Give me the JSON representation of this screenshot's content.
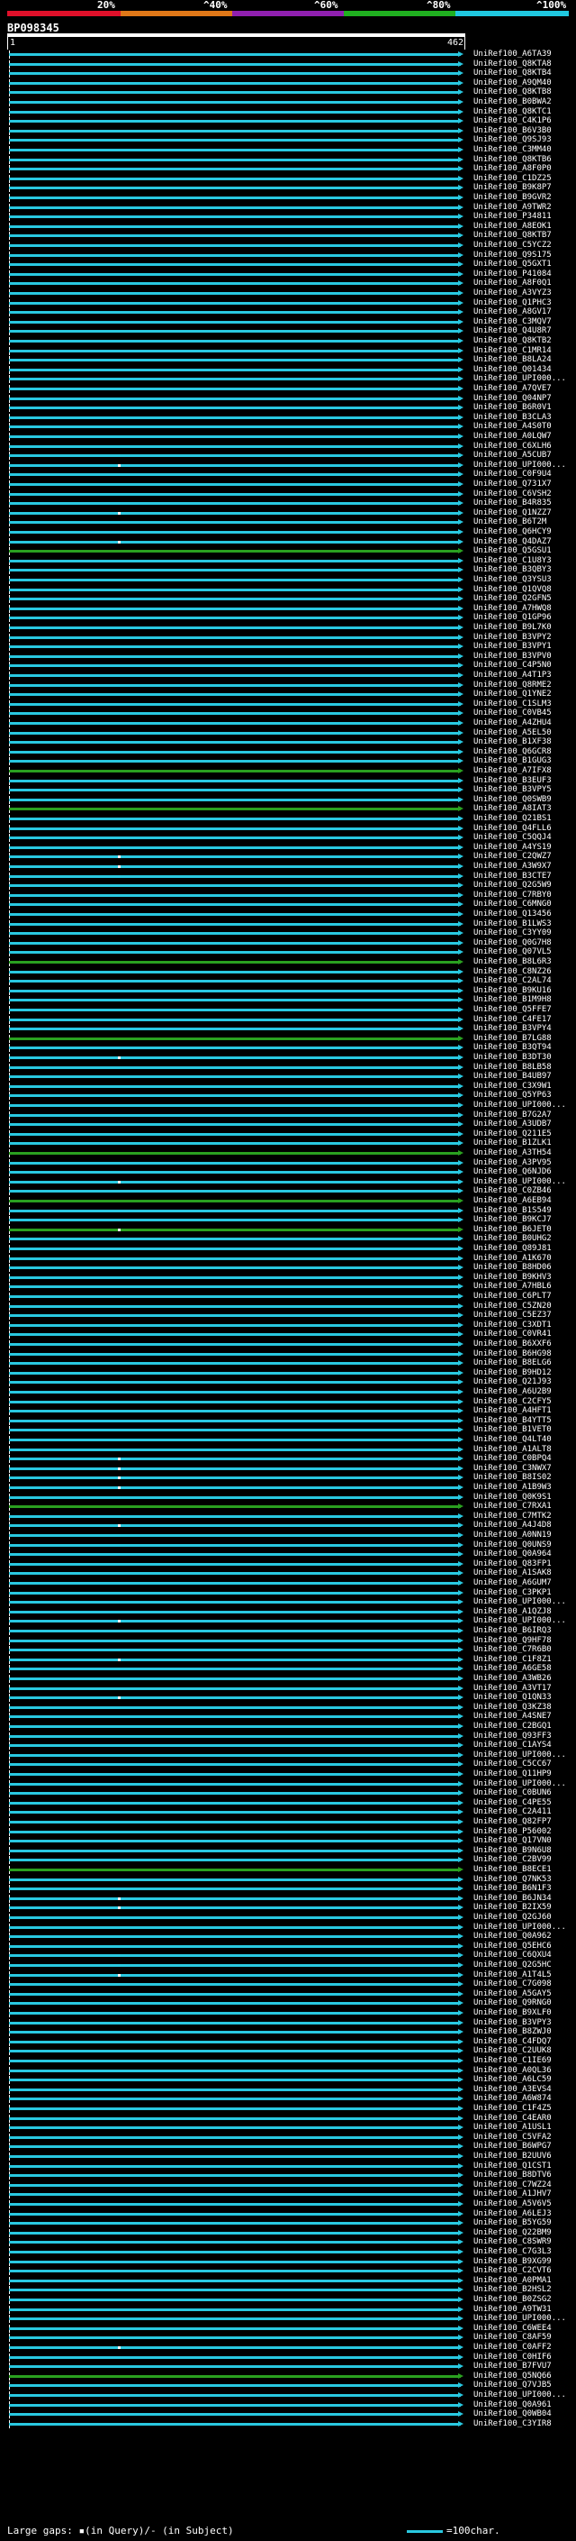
{
  "scale": {
    "labels": [
      "20%",
      "^40%",
      "^60%",
      "^80%",
      "^100%"
    ],
    "colors": [
      "#e0102a",
      "#e07818",
      "#9020b0",
      "#20b020",
      "#20c8e0"
    ]
  },
  "query": {
    "id": "BP098345",
    "start": "1",
    "end": "462"
  },
  "footer": {
    "gaps_text": "Large gaps: ▪(in Query)/- (in Subject)",
    "scale_text": "=100char."
  },
  "colors": {
    "hit_blue": "#29c8e0",
    "hit_green": "#2aa020"
  },
  "hits": [
    {
      "label": "UniRef100_A6TA39",
      "green": false
    },
    {
      "label": "UniRef100_Q8KTA8",
      "green": false
    },
    {
      "label": "UniRef100_Q8KTB4",
      "green": false
    },
    {
      "label": "UniRef100_A9QM40",
      "green": false
    },
    {
      "label": "UniRef100_Q8KTB8",
      "green": false
    },
    {
      "label": "UniRef100_B0BWA2",
      "green": false
    },
    {
      "label": "UniRef100_Q8KTC1",
      "green": false
    },
    {
      "label": "UniRef100_C4K1P6",
      "green": false
    },
    {
      "label": "UniRef100_B6V3B0",
      "green": false
    },
    {
      "label": "UniRef100_Q9SJ93",
      "green": false
    },
    {
      "label": "UniRef100_C3MM40",
      "green": false
    },
    {
      "label": "UniRef100_Q8KTB6",
      "green": false
    },
    {
      "label": "UniRef100_A8F0P0",
      "green": false
    },
    {
      "label": "UniRef100_C1DZ25",
      "green": false
    },
    {
      "label": "UniRef100_B9K8P7",
      "green": false
    },
    {
      "label": "UniRef100_B9GVR2",
      "green": false
    },
    {
      "label": "UniRef100_A9TWR2",
      "green": false
    },
    {
      "label": "UniRef100_P34811",
      "green": false
    },
    {
      "label": "UniRef100_A8EOK1",
      "green": false
    },
    {
      "label": "UniRef100_Q8KTB7",
      "green": false
    },
    {
      "label": "UniRef100_C5YCZ2",
      "green": false
    },
    {
      "label": "UniRef100_Q9S175",
      "green": false
    },
    {
      "label": "UniRef100_Q5GXT1",
      "green": false
    },
    {
      "label": "UniRef100_P41084",
      "green": false
    },
    {
      "label": "UniRef100_A8F0Q1",
      "green": false
    },
    {
      "label": "UniRef100_A3VYZ3",
      "green": false
    },
    {
      "label": "UniRef100_Q1PHC3",
      "green": false
    },
    {
      "label": "UniRef100_A8GV17",
      "green": false
    },
    {
      "label": "UniRef100_C3MQV7",
      "green": false
    },
    {
      "label": "UniRef100_Q4U8R7",
      "green": false
    },
    {
      "label": "UniRef100_Q8KTB2",
      "green": false
    },
    {
      "label": "UniRef100_C1MR14",
      "green": false
    },
    {
      "label": "UniRef100_B8LA24",
      "green": false
    },
    {
      "label": "UniRef100_Q01434",
      "green": false
    },
    {
      "label": "UniRef100_UPI000...",
      "green": false
    },
    {
      "label": "UniRef100_A7QVE7",
      "green": false
    },
    {
      "label": "UniRef100_Q04NP7",
      "green": false
    },
    {
      "label": "UniRef100_B6R0V1",
      "green": false
    },
    {
      "label": "UniRef100_B3CLA3",
      "green": false
    },
    {
      "label": "UniRef100_A4S0T0",
      "green": false
    },
    {
      "label": "UniRef100_A0LQW7",
      "green": false
    },
    {
      "label": "UniRef100_C6XLH6",
      "green": false
    },
    {
      "label": "UniRef100_A5CUB7",
      "green": false
    },
    {
      "label": "UniRef100_UPI000...",
      "green": false
    },
    {
      "label": "UniRef100_C0F9U4",
      "green": false
    },
    {
      "label": "UniRef100_Q731X7",
      "green": false
    },
    {
      "label": "UniRef100_C6VSH2",
      "green": false
    },
    {
      "label": "UniRef100_B4R835",
      "green": false
    },
    {
      "label": "UniRef100_Q1NZZ7",
      "green": false
    },
    {
      "label": "UniRef100_B6T2M",
      "green": false
    },
    {
      "label": "UniRef100_Q6HCY9",
      "green": false
    },
    {
      "label": "UniRef100_Q4DAZ7",
      "green": false
    },
    {
      "label": "UniRef100_Q5GSU1",
      "green": true
    },
    {
      "label": "UniRef100_C1U8Y3",
      "green": false
    },
    {
      "label": "UniRef100_B3QBY3",
      "green": false
    },
    {
      "label": "UniRef100_Q3YSU3",
      "green": false
    },
    {
      "label": "UniRef100_Q1QVQ8",
      "green": false
    },
    {
      "label": "UniRef100_Q2GFN5",
      "green": false
    },
    {
      "label": "UniRef100_A7HWQ8",
      "green": false
    },
    {
      "label": "UniRef100_Q1GP96",
      "green": false
    },
    {
      "label": "UniRef100_B9L7K0",
      "green": false
    },
    {
      "label": "UniRef100_B3VPY2",
      "green": false
    },
    {
      "label": "UniRef100_B3VPY1",
      "green": false
    },
    {
      "label": "UniRef100_B3VPV0",
      "green": false
    },
    {
      "label": "UniRef100_C4P5N0",
      "green": false
    },
    {
      "label": "UniRef100_A4T1P3",
      "green": false
    },
    {
      "label": "UniRef100_Q8RME2",
      "green": false
    },
    {
      "label": "UniRef100_Q1YNE2",
      "green": false
    },
    {
      "label": "UniRef100_C1SLM3",
      "green": false
    },
    {
      "label": "UniRef100_C0VB45",
      "green": false
    },
    {
      "label": "UniRef100_A4ZHU4",
      "green": false
    },
    {
      "label": "UniRef100_A5EL50",
      "green": false
    },
    {
      "label": "UniRef100_B1XF38",
      "green": false
    },
    {
      "label": "UniRef100_Q6GCR8",
      "green": false
    },
    {
      "label": "UniRef100_B1GUG3",
      "green": false
    },
    {
      "label": "UniRef100_A7IFX8",
      "green": true
    },
    {
      "label": "UniRef100_B3EUF3",
      "green": false
    },
    {
      "label": "UniRef100_B3VPY5",
      "green": false
    },
    {
      "label": "UniRef100_Q0SWB9",
      "green": false
    },
    {
      "label": "UniRef100_A8IAT3",
      "green": true
    },
    {
      "label": "UniRef100_Q21BS1",
      "green": false
    },
    {
      "label": "UniRef100_Q4FLL6",
      "green": false
    },
    {
      "label": "UniRef100_C5QQJ4",
      "green": false
    },
    {
      "label": "UniRef100_A4YS19",
      "green": false
    },
    {
      "label": "UniRef100_C2QWZ7",
      "green": false
    },
    {
      "label": "UniRef100_A3W9X7",
      "green": false
    },
    {
      "label": "UniRef100_B3CTE7",
      "green": false
    },
    {
      "label": "UniRef100_Q2G5W9",
      "green": false
    },
    {
      "label": "UniRef100_C7RBY0",
      "green": false
    },
    {
      "label": "UniRef100_C6MNG0",
      "green": false
    },
    {
      "label": "UniRef100_Q13456",
      "green": false
    },
    {
      "label": "UniRef100_B1LWS3",
      "green": false
    },
    {
      "label": "UniRef100_C3YY09",
      "green": false
    },
    {
      "label": "UniRef100_Q0G7H8",
      "green": false
    },
    {
      "label": "UniRef100_Q07VL5",
      "green": false
    },
    {
      "label": "UniRef100_B8L6R3",
      "green": true
    },
    {
      "label": "UniRef100_C8NZ26",
      "green": false
    },
    {
      "label": "UniRef100_C2AL74",
      "green": false
    },
    {
      "label": "UniRef100_B9KU16",
      "green": false
    },
    {
      "label": "UniRef100_B1M9H8",
      "green": false
    },
    {
      "label": "UniRef100_Q5FFE7",
      "green": false
    },
    {
      "label": "UniRef100_C4FE17",
      "green": false
    },
    {
      "label": "UniRef100_B3VPY4",
      "green": false
    },
    {
      "label": "UniRef100_B7LG88",
      "green": true
    },
    {
      "label": "UniRef100_B3QT94",
      "green": false
    },
    {
      "label": "UniRef100_B3DT30",
      "green": false
    },
    {
      "label": "UniRef100_B8LB58",
      "green": false
    },
    {
      "label": "UniRef100_B4UB97",
      "green": false
    },
    {
      "label": "UniRef100_C3X9W1",
      "green": false
    },
    {
      "label": "UniRef100_Q5YP63",
      "green": false
    },
    {
      "label": "UniRef100_UPI000...",
      "green": false
    },
    {
      "label": "UniRef100_B7G2A7",
      "green": false
    },
    {
      "label": "UniRef100_A3UDB7",
      "green": false
    },
    {
      "label": "UniRef100_Q211E5",
      "green": false
    },
    {
      "label": "UniRef100_B1ZLK1",
      "green": false
    },
    {
      "label": "UniRef100_A3TH54",
      "green": true
    },
    {
      "label": "UniRef100_A3PV95",
      "green": false
    },
    {
      "label": "UniRef100_Q6NJD6",
      "green": false
    },
    {
      "label": "UniRef100_UPI000...",
      "green": false
    },
    {
      "label": "UniRef100_C0ZB46",
      "green": false
    },
    {
      "label": "UniRef100_A6EB94",
      "green": true
    },
    {
      "label": "UniRef100_B1S549",
      "green": false
    },
    {
      "label": "UniRef100_B9KCJ7",
      "green": false
    },
    {
      "label": "UniRef100_B6JET0",
      "green": true
    },
    {
      "label": "UniRef100_B0UHG2",
      "green": false
    },
    {
      "label": "UniRef100_Q89J81",
      "green": false
    },
    {
      "label": "UniRef100_A1K670",
      "green": false
    },
    {
      "label": "UniRef100_B8HD06",
      "green": false
    },
    {
      "label": "UniRef100_B9KHV3",
      "green": false
    },
    {
      "label": "UniRef100_A7HBL6",
      "green": false
    },
    {
      "label": "UniRef100_C6PLT7",
      "green": false
    },
    {
      "label": "UniRef100_C5ZN20",
      "green": false
    },
    {
      "label": "UniRef100_C5EZ37",
      "green": false
    },
    {
      "label": "UniRef100_C3XDT1",
      "green": false
    },
    {
      "label": "UniRef100_C0VR41",
      "green": false
    },
    {
      "label": "UniRef100_B6XXF6",
      "green": false
    },
    {
      "label": "UniRef100_B6HG98",
      "green": false
    },
    {
      "label": "UniRef100_B8ELG6",
      "green": false
    },
    {
      "label": "UniRef100_B9HD12",
      "green": false
    },
    {
      "label": "UniRef100_Q21J93",
      "green": false
    },
    {
      "label": "UniRef100_A6U2B9",
      "green": false
    },
    {
      "label": "UniRef100_C2CFY5",
      "green": false
    },
    {
      "label": "UniRef100_A4HFT1",
      "green": false
    },
    {
      "label": "UniRef100_B4YTT5",
      "green": false
    },
    {
      "label": "UniRef100_B1VET0",
      "green": false
    },
    {
      "label": "UniRef100_Q4LT40",
      "green": false
    },
    {
      "label": "UniRef100_A1ALT8",
      "green": false
    },
    {
      "label": "UniRef100_C0BPQ4",
      "green": false
    },
    {
      "label": "UniRef100_C3NWX7",
      "green": false
    },
    {
      "label": "UniRef100_B8IS02",
      "green": false
    },
    {
      "label": "UniRef100_A1B9W3",
      "green": false
    },
    {
      "label": "UniRef100_Q0K9S1",
      "green": false
    },
    {
      "label": "UniRef100_C7RXA1",
      "green": true
    },
    {
      "label": "UniRef100_C7MTK2",
      "green": false
    },
    {
      "label": "UniRef100_A4J4D8",
      "green": false
    },
    {
      "label": "UniRef100_A0NN19",
      "green": false
    },
    {
      "label": "UniRef100_Q0UNS9",
      "green": false
    },
    {
      "label": "UniRef100_Q0A964",
      "green": false
    },
    {
      "label": "UniRef100_Q83FP1",
      "green": false
    },
    {
      "label": "UniRef100_A1SAK8",
      "green": false
    },
    {
      "label": "UniRef100_A6GUM7",
      "green": false
    },
    {
      "label": "UniRef100_C3PKP1",
      "green": false
    },
    {
      "label": "UniRef100_UPI000...",
      "green": false
    },
    {
      "label": "UniRef100_A1QZJ8",
      "green": false
    },
    {
      "label": "UniRef100_UPI000...",
      "green": false
    },
    {
      "label": "UniRef100_B6IRQ3",
      "green": false
    },
    {
      "label": "UniRef100_Q9HF78",
      "green": false
    },
    {
      "label": "UniRef100_C7R6B0",
      "green": false
    },
    {
      "label": "UniRef100_C1F8Z1",
      "green": false
    },
    {
      "label": "UniRef100_A6GE58",
      "green": false
    },
    {
      "label": "UniRef100_A3WB26",
      "green": false
    },
    {
      "label": "UniRef100_A3VT17",
      "green": false
    },
    {
      "label": "UniRef100_Q1QN33",
      "green": false
    },
    {
      "label": "UniRef100_Q3KZ38",
      "green": false
    },
    {
      "label": "UniRef100_A4SNE7",
      "green": false
    },
    {
      "label": "UniRef100_C2BGQ1",
      "green": false
    },
    {
      "label": "UniRef100_Q93FF3",
      "green": false
    },
    {
      "label": "UniRef100_C1AYS4",
      "green": false
    },
    {
      "label": "UniRef100_UPI000...",
      "green": false
    },
    {
      "label": "UniRef100_C5CC67",
      "green": false
    },
    {
      "label": "UniRef100_Q11HP9",
      "green": false
    },
    {
      "label": "UniRef100_UPI000...",
      "green": false
    },
    {
      "label": "UniRef100_C0BUN6",
      "green": false
    },
    {
      "label": "UniRef100_C4PE55",
      "green": false
    },
    {
      "label": "UniRef100_C2A411",
      "green": false
    },
    {
      "label": "UniRef100_Q82FP7",
      "green": false
    },
    {
      "label": "UniRef100_P56002",
      "green": false
    },
    {
      "label": "UniRef100_Q17VN0",
      "green": false
    },
    {
      "label": "UniRef100_B9N6U8",
      "green": false
    },
    {
      "label": "UniRef100_C2BV99",
      "green": false
    },
    {
      "label": "UniRef100_B8ECE1",
      "green": true
    },
    {
      "label": "UniRef100_Q7NK53",
      "green": false
    },
    {
      "label": "UniRef100_B6N1F3",
      "green": false
    },
    {
      "label": "UniRef100_B6JN34",
      "green": false
    },
    {
      "label": "UniRef100_B2IX59",
      "green": false
    },
    {
      "label": "UniRef100_Q2GJ60",
      "green": false
    },
    {
      "label": "UniRef100_UPI000...",
      "green": false
    },
    {
      "label": "UniRef100_Q0A962",
      "green": false
    },
    {
      "label": "UniRef100_Q5EHC6",
      "green": false
    },
    {
      "label": "UniRef100_C6QXU4",
      "green": false
    },
    {
      "label": "UniRef100_Q2G5HC",
      "green": false
    },
    {
      "label": "UniRef100_A1T4L5",
      "green": false
    },
    {
      "label": "UniRef100_C7G098",
      "green": false
    },
    {
      "label": "UniRef100_A5GAY5",
      "green": false
    },
    {
      "label": "UniRef100_Q9RNG0",
      "green": false
    },
    {
      "label": "UniRef100_B9XLF0",
      "green": false
    },
    {
      "label": "UniRef100_B3VPY3",
      "green": false
    },
    {
      "label": "UniRef100_B8ZWJ0",
      "green": false
    },
    {
      "label": "UniRef100_C4FDQ7",
      "green": false
    },
    {
      "label": "UniRef100_C2UUK8",
      "green": false
    },
    {
      "label": "UniRef100_C1IE69",
      "green": false
    },
    {
      "label": "UniRef100_A0QL36",
      "green": false
    },
    {
      "label": "UniRef100_A6LC59",
      "green": false
    },
    {
      "label": "UniRef100_A3EVS4",
      "green": false
    },
    {
      "label": "UniRef100_A6W874",
      "green": false
    },
    {
      "label": "UniRef100_C1F4Z5",
      "green": false
    },
    {
      "label": "UniRef100_C4EAR0",
      "green": false
    },
    {
      "label": "UniRef100_A1USL1",
      "green": false
    },
    {
      "label": "UniRef100_C5VFA2",
      "green": false
    },
    {
      "label": "UniRef100_B6WPG7",
      "green": false
    },
    {
      "label": "UniRef100_B2UUV6",
      "green": false
    },
    {
      "label": "UniRef100_Q1CST1",
      "green": false
    },
    {
      "label": "UniRef100_B8DTV6",
      "green": false
    },
    {
      "label": "UniRef100_C7WZ24",
      "green": false
    },
    {
      "label": "UniRef100_A1JHV7",
      "green": false
    },
    {
      "label": "UniRef100_A5V6V5",
      "green": false
    },
    {
      "label": "UniRef100_A6LEJ3",
      "green": false
    },
    {
      "label": "UniRef100_B5YG59",
      "green": false
    },
    {
      "label": "UniRef100_Q22BM9",
      "green": false
    },
    {
      "label": "UniRef100_C8SWR9",
      "green": false
    },
    {
      "label": "UniRef100_C7G3L3",
      "green": false
    },
    {
      "label": "UniRef100_B9XG99",
      "green": false
    },
    {
      "label": "UniRef100_C2CVT6",
      "green": false
    },
    {
      "label": "UniRef100_A0PMA1",
      "green": false
    },
    {
      "label": "UniRef100_B2HSL2",
      "green": false
    },
    {
      "label": "UniRef100_B0ZSG2",
      "green": false
    },
    {
      "label": "UniRef100_A9TW31",
      "green": false
    },
    {
      "label": "UniRef100_UPI000...",
      "green": false
    },
    {
      "label": "UniRef100_C6WEE4",
      "green": false
    },
    {
      "label": "UniRef100_C8AF59",
      "green": false
    },
    {
      "label": "UniRef100_C0AFF2",
      "green": false
    },
    {
      "label": "UniRef100_C0HIF6",
      "green": false
    },
    {
      "label": "UniRef100_B7FVU7",
      "green": false
    },
    {
      "label": "UniRef100_Q5NQ66",
      "green": true
    },
    {
      "label": "UniRef100_Q7VJB5",
      "green": false
    },
    {
      "label": "UniRef100_UPI000...",
      "green": false
    },
    {
      "label": "UniRef100_Q0A961",
      "green": false
    },
    {
      "label": "UniRef100_Q0WB04",
      "green": false
    },
    {
      "label": "UniRef100_C3YIR8",
      "green": false
    }
  ],
  "gap_marks": [
    43,
    48,
    51,
    84,
    85,
    105,
    118,
    123,
    147,
    148,
    149,
    150,
    154,
    164,
    168,
    172,
    193,
    194,
    201,
    240,
    262,
    263,
    264
  ]
}
